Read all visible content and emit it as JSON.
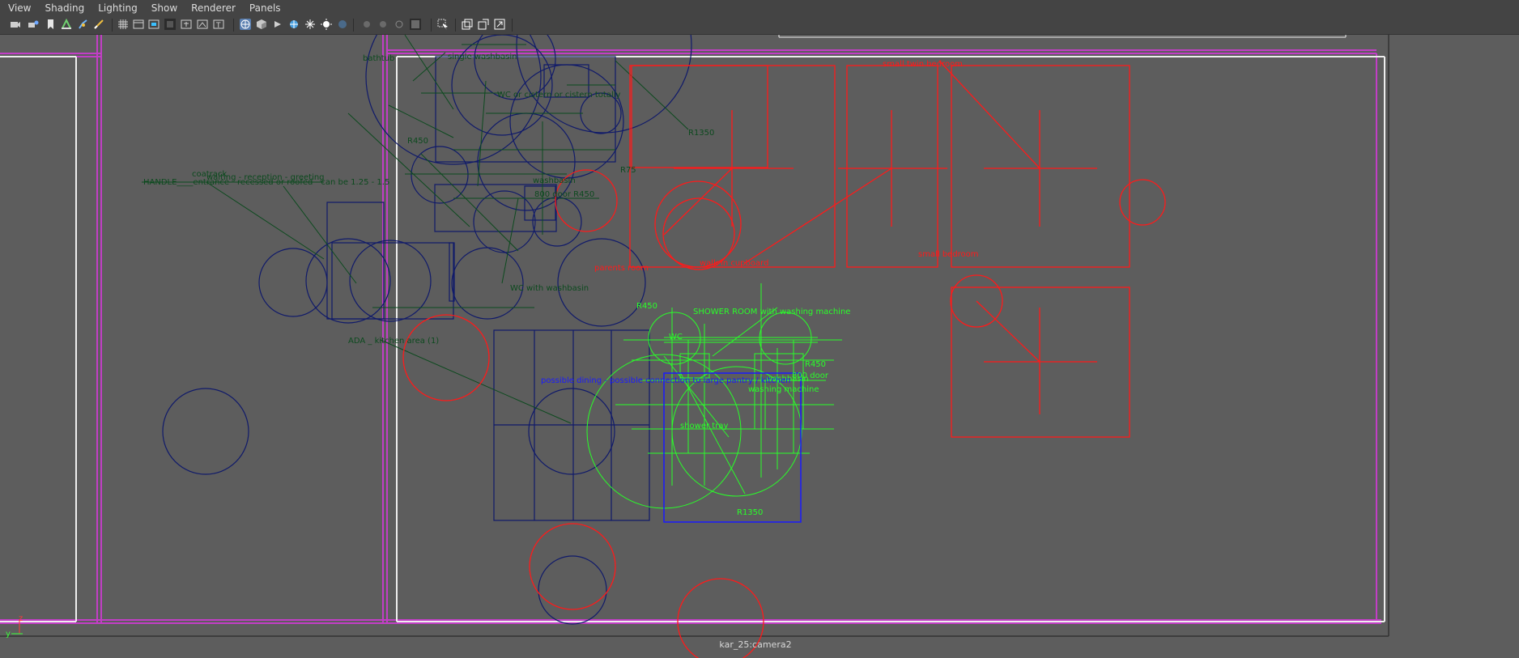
{
  "menus": [
    "View",
    "Shading",
    "Lighting",
    "Show",
    "Renderer",
    "Panels"
  ],
  "toolbar_icons": [
    "camera-icon",
    "camera-attributes-icon",
    "bookmark-icon",
    "image-plane-icon",
    "grease-pencil-icon",
    "film-gate-icon",
    "grid-icon",
    "resolution-gate-icon",
    "gate-mask-icon",
    "field-chart-icon",
    "safe-action-icon",
    "safe-title-icon",
    "wireframe-icon",
    "smooth-shade-icon",
    "default-material-icon",
    "textured-icon",
    "use-lights-icon",
    "shadows-icon",
    "xray-icon",
    "xray-joints-icon",
    "xray-active-icon",
    "backface-icon",
    "isolate-select-icon",
    "select-mode-icon",
    "2d-pan-zoom-icon",
    "grease-pencil-frames-icon",
    "image-plane-toggle-icon"
  ],
  "labels": {
    "bathtub": "bathtub",
    "single_washbasin": "single washbasin",
    "wc_cistern": "WC or cistern or cistern totally",
    "r1350_top": "R1350",
    "r450_left": "R450",
    "r75": "R75",
    "small_twin_bedroom": "small twin bedroom",
    "coatrack": "coatrack",
    "waiting": "waiting - reception - greeting",
    "handle": "HANDLE____entrance - recessed or roofed - can be 1.25 - 1.5",
    "washbasin": "washbasin",
    "door_r450": "800 door R450",
    "parents_room": "parents room",
    "walkin": "walk in cupboard",
    "small_bedroom": "small bedroom",
    "wc_washbasin": "WC with washbasin",
    "r450_shower": "R450",
    "shower_room": "SHOWER ROOM with washing machine",
    "wc": "WC",
    "ada_kitchen": "ADA _ kitchen area (1)",
    "dining": "possible dining - possible connection to large pantry / kitchen",
    "r450_right": "R450",
    "door800": "800 door",
    "washbasin2": "washbasin",
    "washing_machine": "washing machine",
    "shower_tray": "shower tray",
    "r1350_bottom": "R1350",
    "axis_y": "y",
    "axis_z": "z"
  },
  "camera_name": "kar_25:camera2",
  "colors": {
    "background": "#5d5d5d",
    "wall_magenta": "#c23ec6",
    "wall_white": "#eeeeee",
    "dark_green": "#0c4a1e",
    "red": "#ff1a1a",
    "navy": "#101a6a",
    "bright_green": "#29ff29",
    "blue": "#1a1aff"
  }
}
